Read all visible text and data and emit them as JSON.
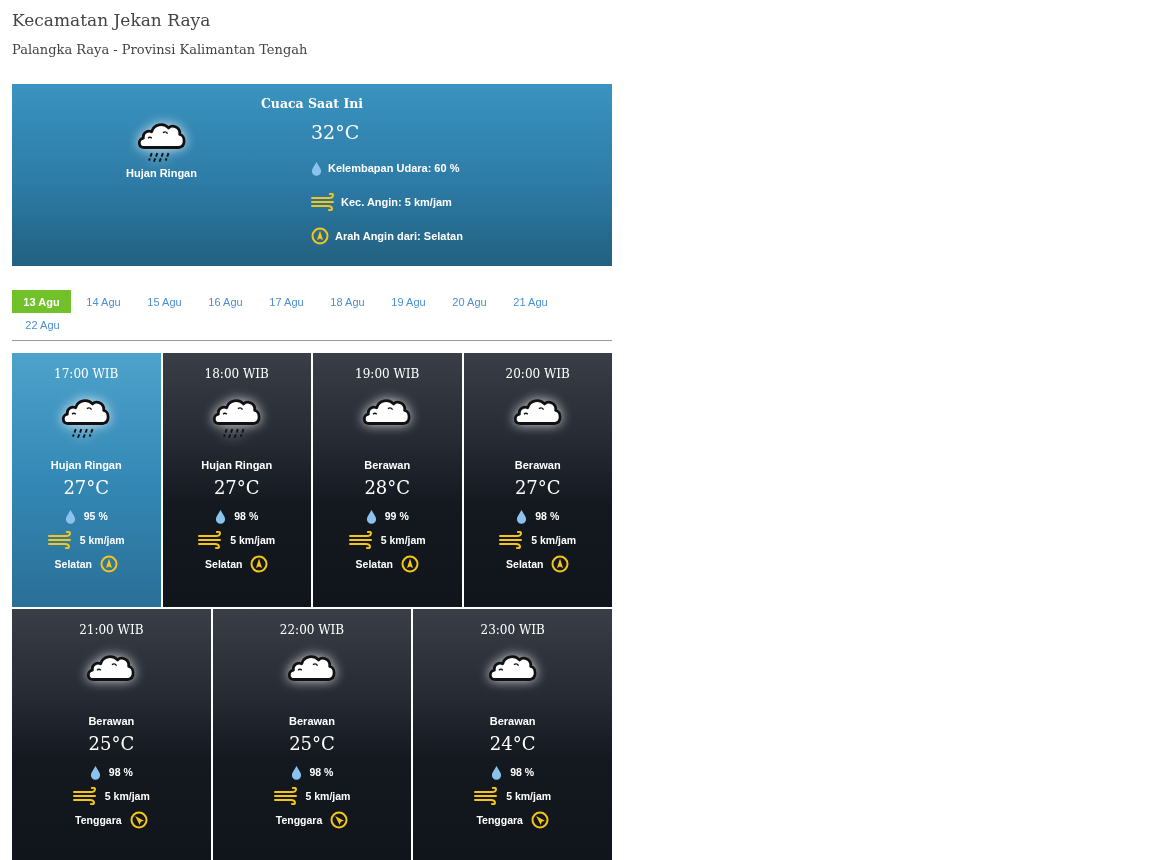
{
  "location": {
    "title": "Kecamatan Jekan Raya",
    "subtitle": "Palangka Raya - Provinsi Kalimantan Tengah"
  },
  "current": {
    "heading": "Cuaca Saat Ini",
    "kind": "rain",
    "condition": "Hujan Ringan",
    "temperature": "32°C",
    "humidity": "Kelembapan Udara: 60 %",
    "wind": {
      "kind": "south",
      "speed": "Kec. Angin: 5 km/jam",
      "direction": "Arah Angin dari: Selatan"
    }
  },
  "days": [
    {
      "label": "13 Agu",
      "selected": true
    },
    {
      "label": "14 Agu",
      "selected": false
    },
    {
      "label": "15 Agu",
      "selected": false
    },
    {
      "label": "16 Agu",
      "selected": false
    },
    {
      "label": "17 Agu",
      "selected": false
    },
    {
      "label": "18 Agu",
      "selected": false
    },
    {
      "label": "19 Agu",
      "selected": false
    },
    {
      "label": "20 Agu",
      "selected": false
    },
    {
      "label": "21 Agu",
      "selected": false
    },
    {
      "label": "22 Agu",
      "selected": false
    }
  ],
  "forecast": [
    {
      "time": "17:00 WIB",
      "selected": true,
      "kind": "rain",
      "condition": "Hujan Ringan",
      "temperature": "27°C",
      "humidity": "95 %",
      "wind": {
        "kind": "south",
        "speed": "5 km/jam",
        "direction": "Selatan"
      }
    },
    {
      "time": "18:00 WIB",
      "selected": false,
      "kind": "rain",
      "condition": "Hujan Ringan",
      "temperature": "27°C",
      "humidity": "98 %",
      "wind": {
        "kind": "south",
        "speed": "5 km/jam",
        "direction": "Selatan"
      }
    },
    {
      "time": "19:00 WIB",
      "selected": false,
      "kind": "cloud",
      "condition": "Berawan",
      "temperature": "28°C",
      "humidity": "99 %",
      "wind": {
        "kind": "south",
        "speed": "5 km/jam",
        "direction": "Selatan"
      }
    },
    {
      "time": "20:00 WIB",
      "selected": false,
      "kind": "cloud",
      "condition": "Berawan",
      "temperature": "27°C",
      "humidity": "98 %",
      "wind": {
        "kind": "south",
        "speed": "5 km/jam",
        "direction": "Selatan"
      }
    },
    {
      "time": "21:00 WIB",
      "selected": false,
      "kind": "cloud",
      "condition": "Berawan",
      "temperature": "25°C",
      "humidity": "98 %",
      "wind": {
        "kind": "southeast",
        "speed": "5 km/jam",
        "direction": "Tenggara"
      }
    },
    {
      "time": "22:00 WIB",
      "selected": false,
      "kind": "cloud",
      "condition": "Berawan",
      "temperature": "25°C",
      "humidity": "98 %",
      "wind": {
        "kind": "southeast",
        "speed": "5 km/jam",
        "direction": "Tenggara"
      }
    },
    {
      "time": "23:00 WIB",
      "selected": false,
      "kind": "cloud",
      "condition": "Berawan",
      "temperature": "24°C",
      "humidity": "98 %",
      "wind": {
        "kind": "southeast",
        "speed": "5 km/jam",
        "direction": "Tenggara"
      }
    }
  ]
}
